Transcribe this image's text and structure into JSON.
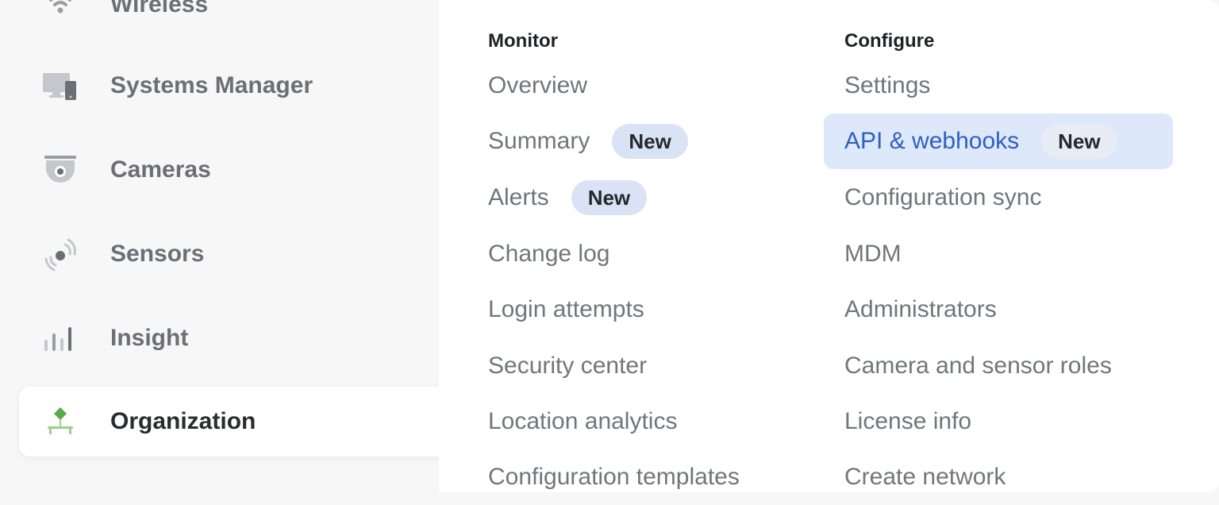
{
  "sidebar": {
    "items": [
      {
        "label": "Wireless",
        "icon": "wifi-icon"
      },
      {
        "label": "Systems Manager",
        "icon": "devices-icon"
      },
      {
        "label": "Cameras",
        "icon": "camera-icon"
      },
      {
        "label": "Sensors",
        "icon": "sensor-icon"
      },
      {
        "label": "Insight",
        "icon": "insight-icon"
      },
      {
        "label": "Organization",
        "icon": "organization-icon",
        "active": true
      }
    ]
  },
  "menu": {
    "monitor": {
      "heading": "Monitor",
      "items": [
        {
          "label": "Overview"
        },
        {
          "label": "Summary",
          "badge": "New"
        },
        {
          "label": "Alerts",
          "badge": "New"
        },
        {
          "label": "Change log"
        },
        {
          "label": "Login attempts"
        },
        {
          "label": "Security center"
        },
        {
          "label": "Location analytics"
        },
        {
          "label": "Configuration templates"
        }
      ]
    },
    "configure": {
      "heading": "Configure",
      "items": [
        {
          "label": "Settings"
        },
        {
          "label": "API & webhooks",
          "badge": "New",
          "selected": true
        },
        {
          "label": "Configuration sync"
        },
        {
          "label": "MDM"
        },
        {
          "label": "Administrators"
        },
        {
          "label": "Camera and sensor roles"
        },
        {
          "label": "License info"
        },
        {
          "label": "Create network"
        }
      ]
    }
  },
  "colors": {
    "accent": "#2f5fbf",
    "selected_bg": "#dde8fb",
    "badge_bg": "#d9e3f5",
    "org_icon_green": "#5aa84e"
  }
}
